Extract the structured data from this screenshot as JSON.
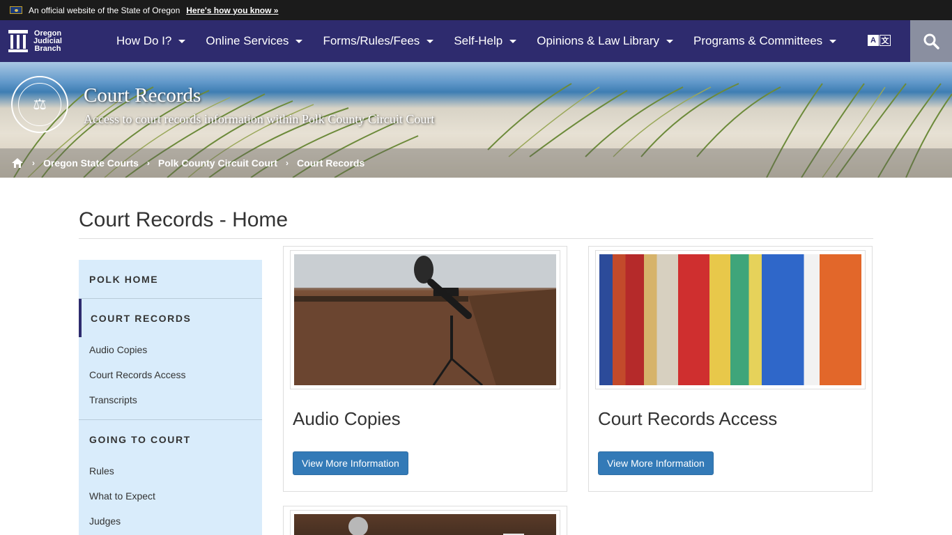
{
  "official_banner": {
    "text": "An official website of the State of Oregon",
    "link": "Here's how you know »"
  },
  "logo": {
    "line1": "Oregon",
    "line2": "Judicial",
    "line3": "Branch"
  },
  "nav": {
    "items": [
      "How Do I?",
      "Online Services",
      "Forms/Rules/Fees",
      "Self-Help",
      "Opinions & Law Library",
      "Programs & Committees"
    ],
    "translate_a": "A",
    "translate_b": "文"
  },
  "hero": {
    "title": "Court Records",
    "subtitle": "Access to court records information within Polk County Circuit Court",
    "breadcrumbs": [
      "Oregon State Courts",
      "Polk County Circuit Court",
      "Court Records"
    ]
  },
  "page": {
    "title": "Court Records - Home"
  },
  "sidebar": {
    "section1": "POLK HOME",
    "section2": "COURT RECORDS",
    "links1": [
      "Audio Copies",
      "Court Records Access",
      "Transcripts"
    ],
    "section3": "GOING TO COURT",
    "links2": [
      "Rules",
      "What to Expect",
      "Judges"
    ]
  },
  "cards": [
    {
      "title": "Audio Copies",
      "button": "View More Information"
    },
    {
      "title": "Court Records Access",
      "button": "View More Information"
    }
  ],
  "colors": {
    "nav_bg": "#2e2b6e",
    "sidebar_bg": "#d9ecfb",
    "button": "#337ab7"
  }
}
